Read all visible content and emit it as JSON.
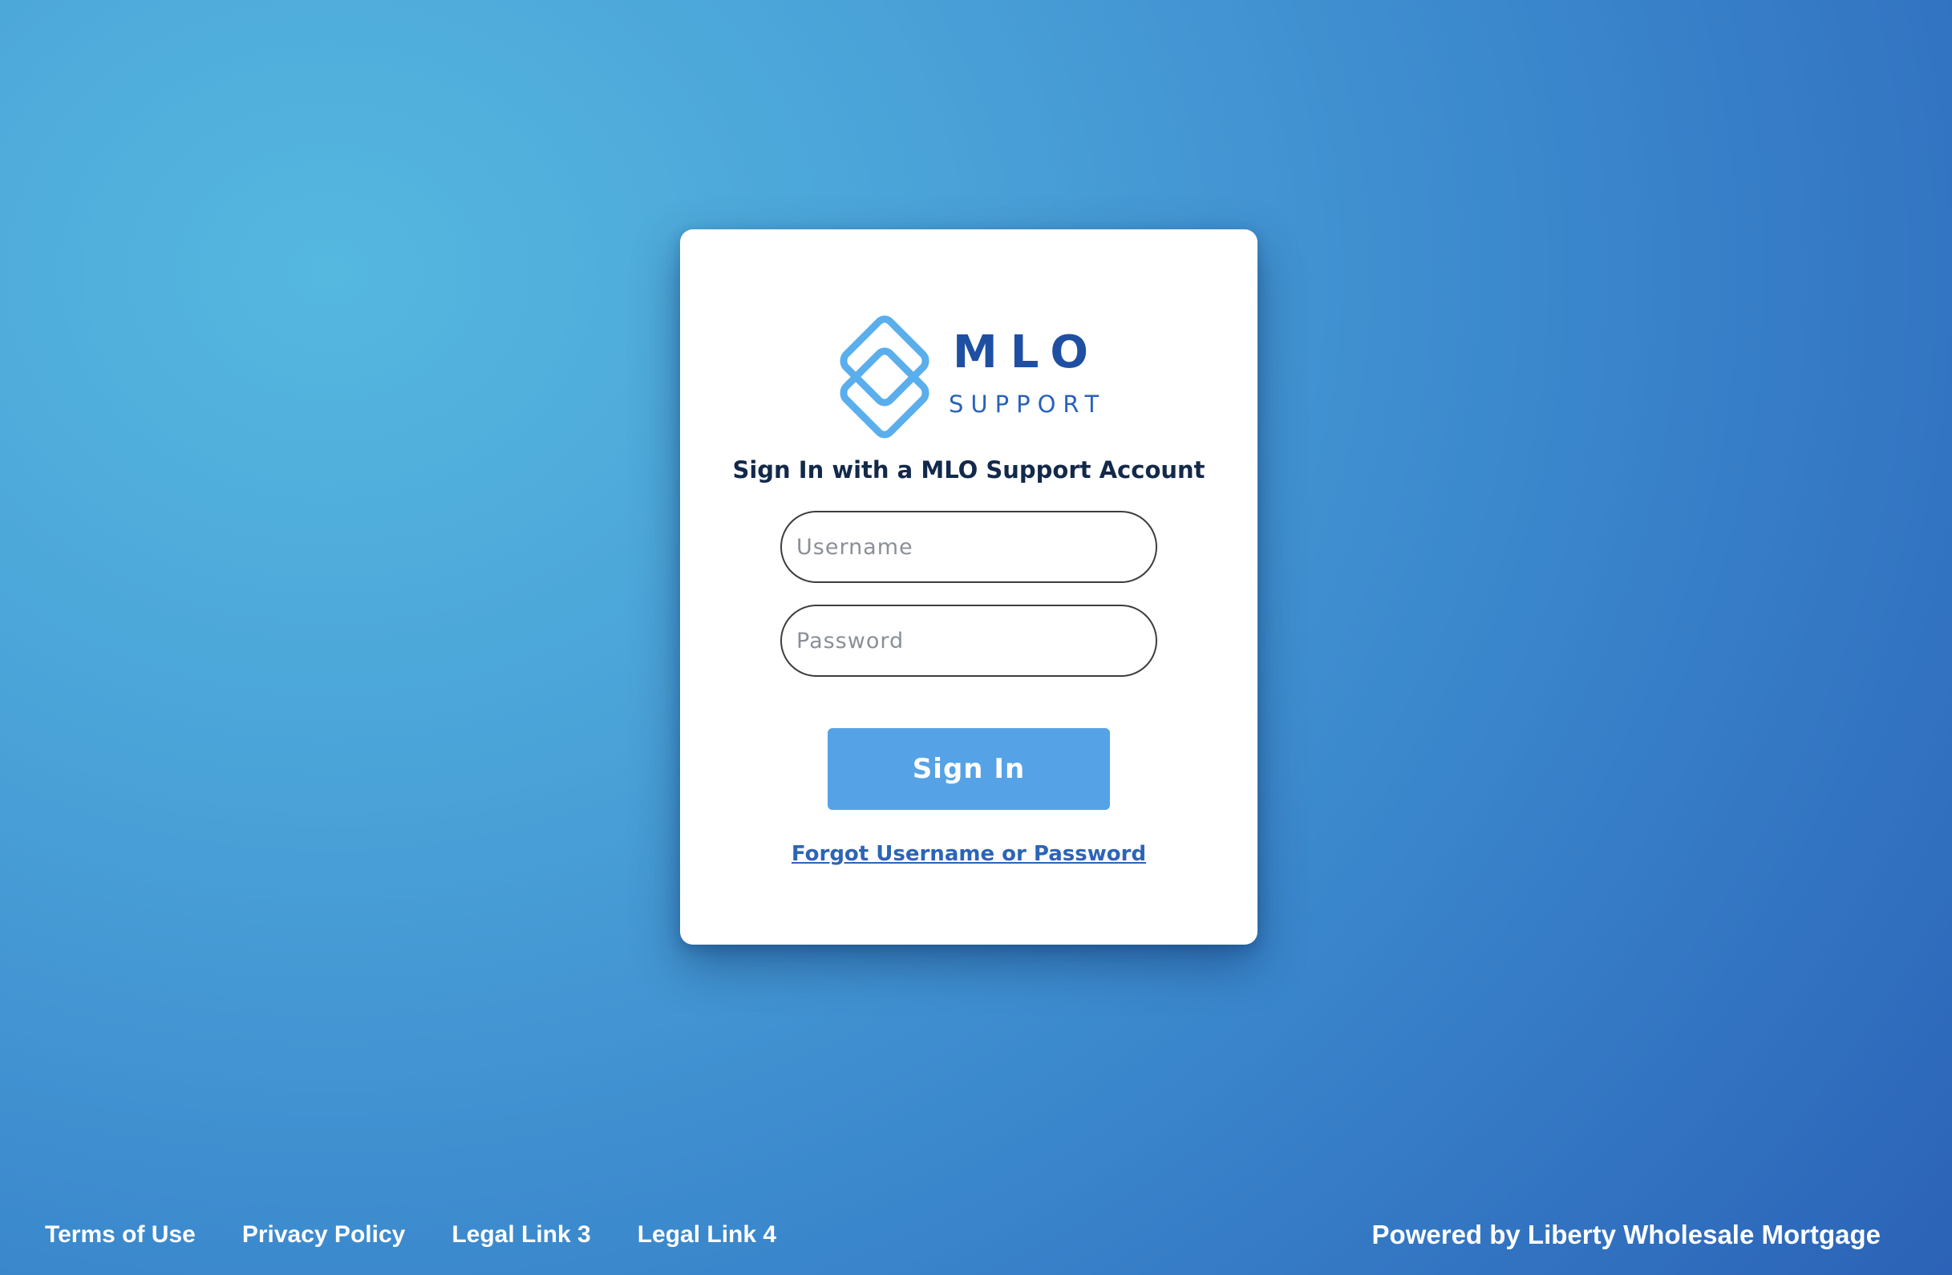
{
  "logo": {
    "title": "MLO",
    "subtitle": "SUPPORT",
    "icon": "interlocked-diamonds-icon",
    "primary_color": "#1e4fa3",
    "icon_color": "#5aaeec"
  },
  "login": {
    "heading": "Sign In with a MLO Support Account",
    "username_placeholder": "Username",
    "username_value": "",
    "password_placeholder": "Password",
    "password_value": "",
    "signin_label": "Sign In",
    "forgot_label": "Forgot Username or Password",
    "button_color": "#55a3e6"
  },
  "footer": {
    "links": [
      {
        "label": "Terms of Use"
      },
      {
        "label": "Privacy Policy"
      },
      {
        "label": "Legal Link 3"
      },
      {
        "label": "Legal Link 4"
      }
    ],
    "powered_by": "Powered by Liberty Wholesale Mortgage"
  }
}
